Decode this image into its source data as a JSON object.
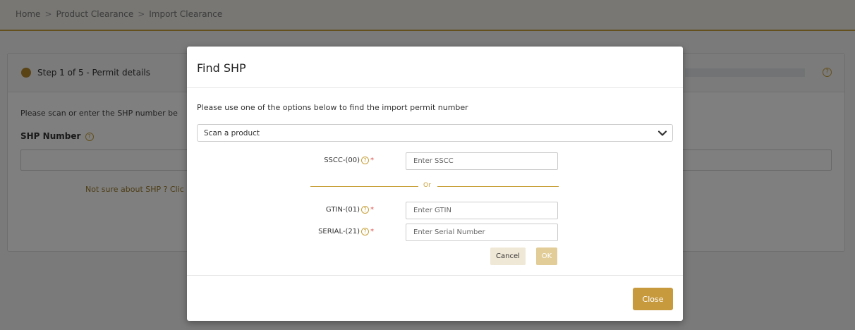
{
  "breadcrumb": {
    "items": [
      "Home",
      "Product Clearance",
      "Import Clearance"
    ],
    "separator": ">"
  },
  "step": {
    "title": "Step 1 of 5 - Permit details"
  },
  "background_form": {
    "intro": "Please scan or enter the SHP number be",
    "shp_label": "SHP Number",
    "not_sure": "Not sure about SHP ? Clic"
  },
  "modal": {
    "title": "Find SHP",
    "description": "Please use one of the options below to find the import permit number",
    "select_value": "Scan a product",
    "sscc": {
      "label": "SSCC-(00)",
      "placeholder": "Enter SSCC"
    },
    "or_text": "Or",
    "gtin": {
      "label": "GTIN-(01)",
      "placeholder": "Enter GTIN"
    },
    "serial": {
      "label": "SERIAL-(21)",
      "placeholder": "Enter Serial Number"
    },
    "cancel_label": "Cancel",
    "ok_label": "OK",
    "close_label": "Close",
    "help_glyph": "?",
    "required_glyph": "*"
  },
  "colors": {
    "accent": "#c79a3e",
    "required": "#d9534f"
  }
}
